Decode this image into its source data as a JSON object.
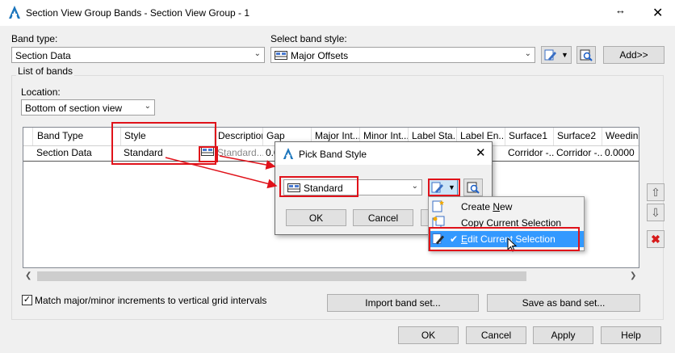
{
  "window": {
    "title": "Section View Group Bands - Section View Group - 1",
    "resize_glyph": "↔",
    "close_glyph": "✕"
  },
  "band_type": {
    "label": "Band type:",
    "value": "Section Data"
  },
  "band_style": {
    "label": "Select band style:",
    "value": "Major Offsets"
  },
  "add_button": "Add>>",
  "list_group": {
    "label": "List of bands"
  },
  "location": {
    "label": "Location:",
    "value": "Bottom of section view"
  },
  "grid": {
    "columns": [
      "Band Type",
      "Style",
      "Description",
      "Gap",
      "Major Int...",
      "Minor Int...",
      "Label Sta...",
      "Label En...",
      "Surface1",
      "Surface2",
      "Weeding"
    ],
    "rows": [
      [
        "Section Data",
        "Standard",
        "Standard...",
        "0.0",
        "",
        "",
        "",
        "",
        "Corridor -...",
        "Corridor -...",
        "0.0000"
      ]
    ]
  },
  "match_checkbox": {
    "label": "Match major/minor increments to vertical grid intervals",
    "checked": true
  },
  "import_button": "Import band set...",
  "save_button": "Save as band set...",
  "footer": {
    "ok": "OK",
    "cancel": "Cancel",
    "apply": "Apply",
    "help": "Help"
  },
  "pick_dialog": {
    "title": "Pick Band Style",
    "style_value": "Standard",
    "ok": "OK",
    "cancel": "Cancel"
  },
  "menu": {
    "items": [
      {
        "prefix": "Create ",
        "accel": "N",
        "suffix": "ew"
      },
      {
        "prefix": "C",
        "accel": "o",
        "suffix": "py Current Selection"
      },
      {
        "prefix": "",
        "accel": "E",
        "suffix": "dit Current Selection",
        "checked": true
      }
    ]
  },
  "colors": {
    "highlight": "#e0121a",
    "selection": "#3399ff",
    "autocad_logo": "#1b75bc"
  }
}
